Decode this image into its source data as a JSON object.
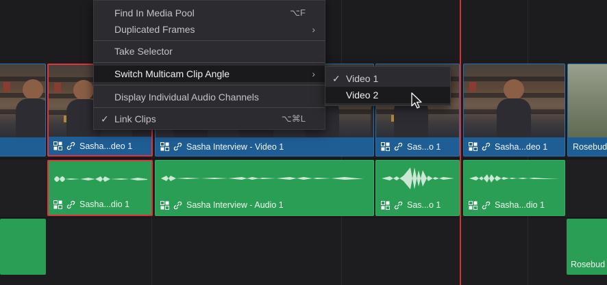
{
  "context_menu": {
    "items": [
      {
        "label": "Find In Media Pool",
        "shortcut": "⌥F"
      },
      {
        "label": "Duplicated Frames",
        "submenu": "›"
      },
      {
        "label": "Take Selector"
      },
      {
        "label": "Switch Multicam Clip Angle",
        "submenu": "›",
        "highlighted": true
      },
      {
        "label": "Display Individual Audio Channels"
      },
      {
        "label": "Link Clips",
        "shortcut": "⌥⌘L",
        "checked": "✓"
      }
    ]
  },
  "submenu": {
    "items": [
      {
        "label": "Video 1",
        "checked": "✓"
      },
      {
        "label": "Video 2",
        "highlighted": true
      }
    ]
  },
  "video_clips": [
    {
      "label": ""
    },
    {
      "label": "Sasha...deo 1",
      "selected": true
    },
    {
      "label": "Sasha Interview - Video 1"
    },
    {
      "label": "Sas...o 1"
    },
    {
      "label": "Sasha...deo 1"
    },
    {
      "label": "Rosebud"
    }
  ],
  "audio_clips": [
    {
      "label": "Sasha...dio 1",
      "selected": true
    },
    {
      "label": "Sasha Interview - Audio 1"
    },
    {
      "label": "Sas...o 1"
    },
    {
      "label": "Sasha...dio 1"
    }
  ],
  "lower_clips": [
    {
      "label": ""
    },
    {
      "label": "Rosebud"
    }
  ],
  "icons": {
    "multicam": "multicam-clip-icon",
    "link": "link-icon",
    "cursor": "mouse-pointer-icon"
  },
  "colors": {
    "video_clip": "#1f5d95",
    "audio_clip": "#2a9e55",
    "selection": "#e2353a",
    "playhead": "#d63232"
  }
}
